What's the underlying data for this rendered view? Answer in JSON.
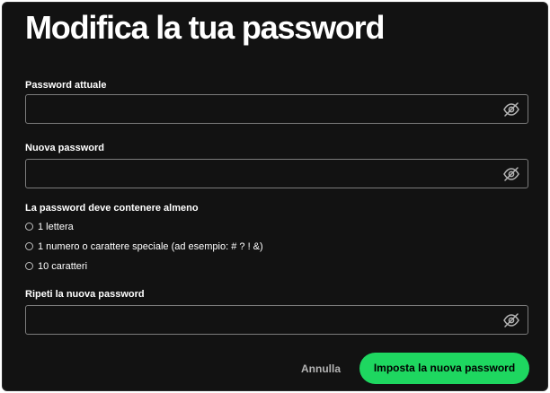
{
  "page": {
    "title": "Modifica la tua password"
  },
  "current_password": {
    "label": "Password attuale",
    "value": "",
    "icon": "eye-slash-icon"
  },
  "new_password": {
    "label": "Nuova password",
    "value": "",
    "icon": "eye-slash-icon"
  },
  "requirements": {
    "heading": "La password deve contenere almeno",
    "items": [
      "1 lettera",
      "1 numero o carattere speciale (ad esempio: # ? ! &)",
      "10 caratteri"
    ]
  },
  "repeat_password": {
    "label": "Ripeti la nuova password",
    "value": "",
    "icon": "eye-slash-icon"
  },
  "actions": {
    "cancel_label": "Annulla",
    "submit_label": "Imposta la nuova password"
  },
  "colors": {
    "background": "#121212",
    "accent": "#1ed760",
    "text": "#ffffff",
    "muted_text": "#b3b3b3",
    "field_border": "#7c7c7c"
  }
}
